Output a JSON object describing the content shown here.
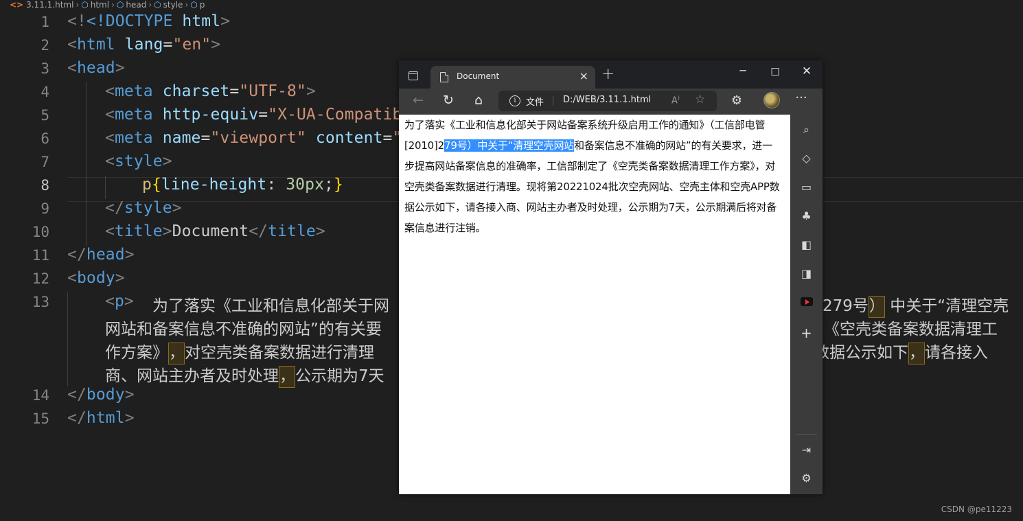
{
  "breadcrumb": [
    "3.11.1.html",
    "html",
    "head",
    "style",
    "p"
  ],
  "editor": {
    "line_numbers": [
      "1",
      "2",
      "3",
      "4",
      "5",
      "6",
      "7",
      "8",
      "9",
      "10",
      "11",
      "12",
      "13",
      "14",
      "15"
    ],
    "doctype": "<!DOCTYPE",
    "html_kw": "html",
    "lang_val": "\"en\"",
    "charset_val": "\"UTF-8\"",
    "http_equiv_val": "\"X-UA-Compatib",
    "viewport_val": "\"viewport\"",
    "content_frag": "\"v",
    "css_selector": "p",
    "css_prop": "line-height",
    "css_value": "30px",
    "title_text": "Document",
    "para_line1a": "为了落实《工业和信息化部关于网",
    "para_line1b": "279号",
    "para_line1c": "中关于“清理空壳",
    "para_line2a": "网站和备案信息不准确的网站”的有关要",
    "para_line2b": "《空壳类备案数据清理工",
    "para_line3a": "作方案》",
    "para_line3b": "对空壳类备案数据进行清理",
    "para_line3c": "数据公示如下",
    "para_line3d": "请各接入",
    "para_line4a": "商、网站主办者及时处理",
    "para_line4b": "公示期为7天"
  },
  "browser": {
    "tab_title": "Document",
    "address_label": "文件",
    "address_url": "D:/WEB/3.11.1.html",
    "page_text_before": "为了落实《工业和信息化部关于网站备案系统升级启用工作的通知》（工信部电管[2010]2",
    "page_text_selected": "79号）中关于“清理空壳网站",
    "page_text_after": "和备案信息不准确的网站”的有关要求，进一步提高网站备案信息的准确率，工信部制定了《空壳类备案数据清理工作方案》，对空壳类备案数据进行清理。现将第20221024批次空壳网站、空壳主体和空壳APP数据公示如下，请各接入商、网站主办者及时处理，公示期为7天，公示期满后将对备案信息进行注销。"
  },
  "watermark": "CSDN @pe11223"
}
